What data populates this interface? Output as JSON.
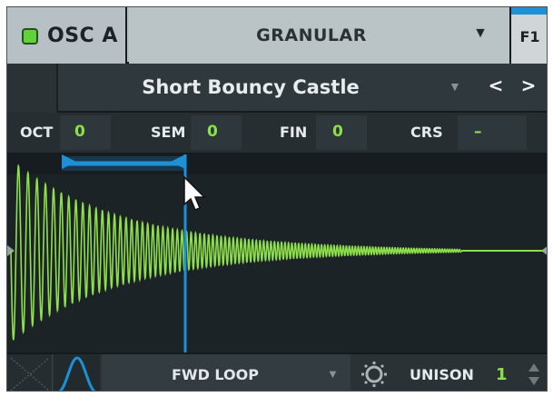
{
  "oscillator": {
    "label": "OSC A",
    "enabled": true,
    "led_color": "#61d33a"
  },
  "mode": {
    "label": "GRANULAR",
    "dropdown_icon": "triangle-down-icon"
  },
  "filter_button": {
    "label": "F1",
    "accent_color": "#1e90d6"
  },
  "preset": {
    "name": "Short Bouncy Castle",
    "dropdown_icon": "triangle-down-icon",
    "prev_label": "<",
    "next_label": ">"
  },
  "tuning": [
    {
      "label": "OCT",
      "value": "0"
    },
    {
      "label": "SEM",
      "value": "0"
    },
    {
      "label": "FIN",
      "value": "0"
    },
    {
      "label": "CRS",
      "value": "–"
    }
  ],
  "waveform": {
    "color": "#8ee04a",
    "region_color": "#1e90d6",
    "cursor_icon": "mouse-pointer-icon"
  },
  "bottom": {
    "loop_mode": "FWD LOOP",
    "unison_label": "UNISON",
    "unison_value": "1",
    "settings_icon": "gear-icon",
    "envelope_icon": "bell-curve-icon",
    "crossfade_icon": "crossfade-icon"
  },
  "colors": {
    "accent_green": "#8ee04a",
    "accent_blue": "#1e90d6",
    "panel_dark": "#1f2528",
    "header_gray": "#b3bcc0"
  }
}
